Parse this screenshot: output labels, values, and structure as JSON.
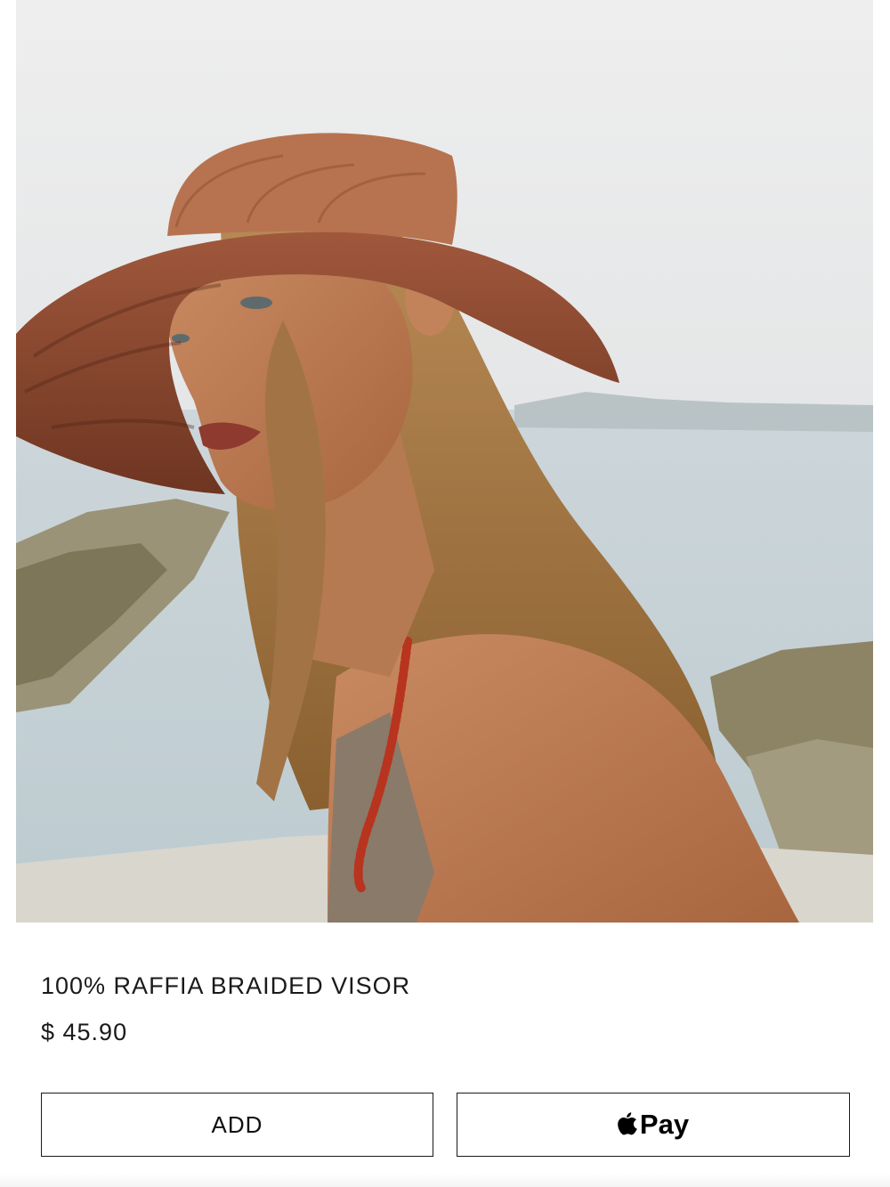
{
  "product": {
    "image_alt": "Model wearing a braided raffia visor on a beach",
    "title": "100% RAFFIA BRAIDED VISOR",
    "price": "$ 45.90"
  },
  "actions": {
    "add_label": "ADD",
    "pay_icon": "apple-icon",
    "pay_label": "Pay"
  }
}
